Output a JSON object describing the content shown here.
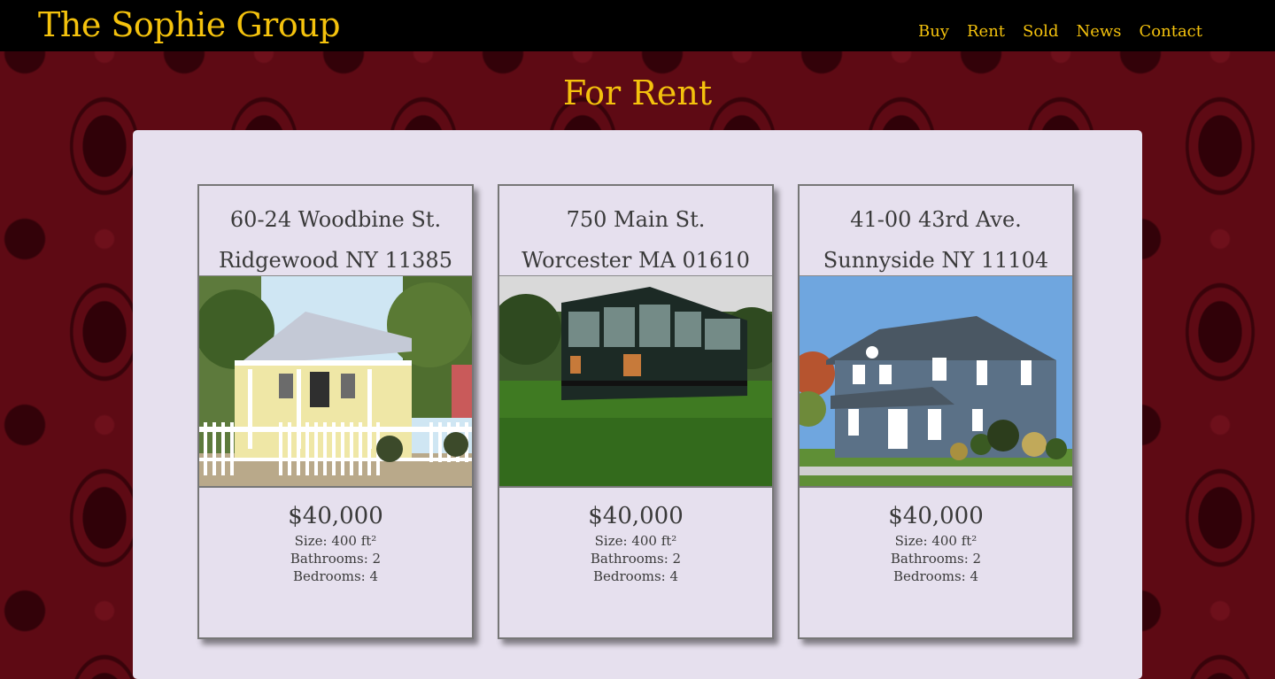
{
  "header": {
    "brand": "The Sophie Group",
    "nav": [
      "Buy",
      "Rent",
      "Sold",
      "News",
      "Contact"
    ]
  },
  "page": {
    "title": "For Rent"
  },
  "listings": [
    {
      "street": "60-24 Woodbine St.",
      "city": "Ridgewood NY 11385",
      "photo": "yellow-cottage-photo",
      "price": "$40,000",
      "size": "Size: 400 ft²",
      "bathrooms": "Bathrooms: 2",
      "bedrooms": "Bedrooms: 4"
    },
    {
      "street": "750 Main St.",
      "city": "Worcester MA 01610",
      "photo": "glass-house-photo",
      "price": "$40,000",
      "size": "Size: 400 ft²",
      "bathrooms": "Bathrooms: 2",
      "bedrooms": "Bedrooms: 4"
    },
    {
      "street": "41-00 43rd Ave.",
      "city": "Sunnyside NY 11104",
      "photo": "blue-house-photo",
      "price": "$40,000",
      "size": "Size: 400 ft²",
      "bathrooms": "Bathrooms: 2",
      "bedrooms": "Bedrooms: 4"
    }
  ],
  "colors": {
    "accent": "#f4c20d",
    "header_bg": "#000000",
    "panel_bg": "#e6e0ee",
    "wallpaper": "#5e0a14"
  }
}
